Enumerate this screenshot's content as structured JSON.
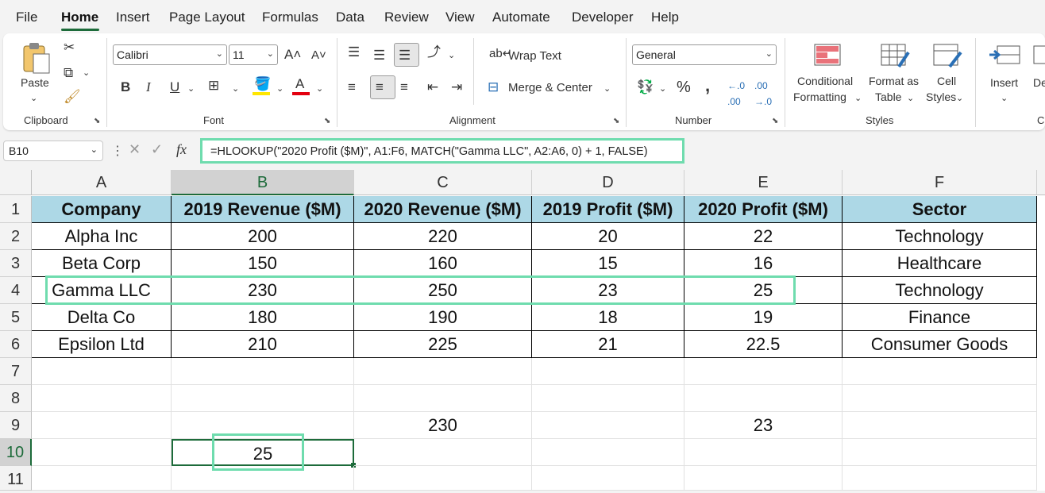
{
  "menu": {
    "tabs": [
      {
        "label": "File"
      },
      {
        "label": "Home"
      },
      {
        "label": "Insert"
      },
      {
        "label": "Page Layout"
      },
      {
        "label": "Formulas"
      },
      {
        "label": "Data"
      },
      {
        "label": "Review"
      },
      {
        "label": "View"
      },
      {
        "label": "Automate"
      },
      {
        "label": "Developer"
      },
      {
        "label": "Help"
      }
    ],
    "active": "Home"
  },
  "ribbon": {
    "clipboard": {
      "paste_label": "Paste",
      "group_label": "Clipboard"
    },
    "font": {
      "family": "Calibri",
      "size": "11",
      "group_label": "Font",
      "bold": "B",
      "italic": "I",
      "underline": "U"
    },
    "alignment": {
      "wrap_text": "Wrap Text",
      "merge_center": "Merge & Center",
      "group_label": "Alignment"
    },
    "number": {
      "format": "General",
      "group_label": "Number"
    },
    "styles": {
      "conditional_line1": "Conditional",
      "conditional_line2": "Formatting",
      "format_table_line1": "Format as",
      "format_table_line2": "Table",
      "cell_styles_line1": "Cell",
      "cell_styles_line2": "Styles",
      "group_label": "Styles"
    },
    "cells": {
      "insert_label": "Insert",
      "delete_label": "De",
      "group_label": "C"
    }
  },
  "formula_bar": {
    "name_box": "B10",
    "fx": "fx",
    "formula": "=HLOOKUP(\"2020 Profit ($M)\", A1:F6, MATCH(\"Gamma LLC\", A2:A6, 0) + 1, FALSE)"
  },
  "sheet": {
    "columns": [
      "A",
      "B",
      "C",
      "D",
      "E",
      "F"
    ],
    "rows": [
      "1",
      "2",
      "3",
      "4",
      "5",
      "6",
      "7",
      "8",
      "9",
      "10",
      "11"
    ],
    "selected_column": "B",
    "selected_row": "10",
    "header": [
      "Company",
      "2019 Revenue ($M)",
      "2020 Revenue ($M)",
      "2019 Profit ($M)",
      "2020 Profit ($M)",
      "Sector"
    ],
    "data": [
      [
        "Alpha Inc",
        "200",
        "220",
        "20",
        "22",
        "Technology"
      ],
      [
        "Beta Corp",
        "150",
        "160",
        "15",
        "16",
        "Healthcare"
      ],
      [
        "Gamma LLC",
        "230",
        "250",
        "23",
        "25",
        "Technology"
      ],
      [
        "Delta Co",
        "180",
        "190",
        "18",
        "19",
        "Finance"
      ],
      [
        "Epsilon Ltd",
        "210",
        "225",
        "21",
        "22.5",
        "Consumer Goods"
      ]
    ],
    "c9": "230",
    "e9": "23",
    "b10": "25"
  },
  "colors": {
    "accent": "#1d6b3a",
    "highlight": "#6fdcae",
    "header_fill": "#add8e6"
  }
}
